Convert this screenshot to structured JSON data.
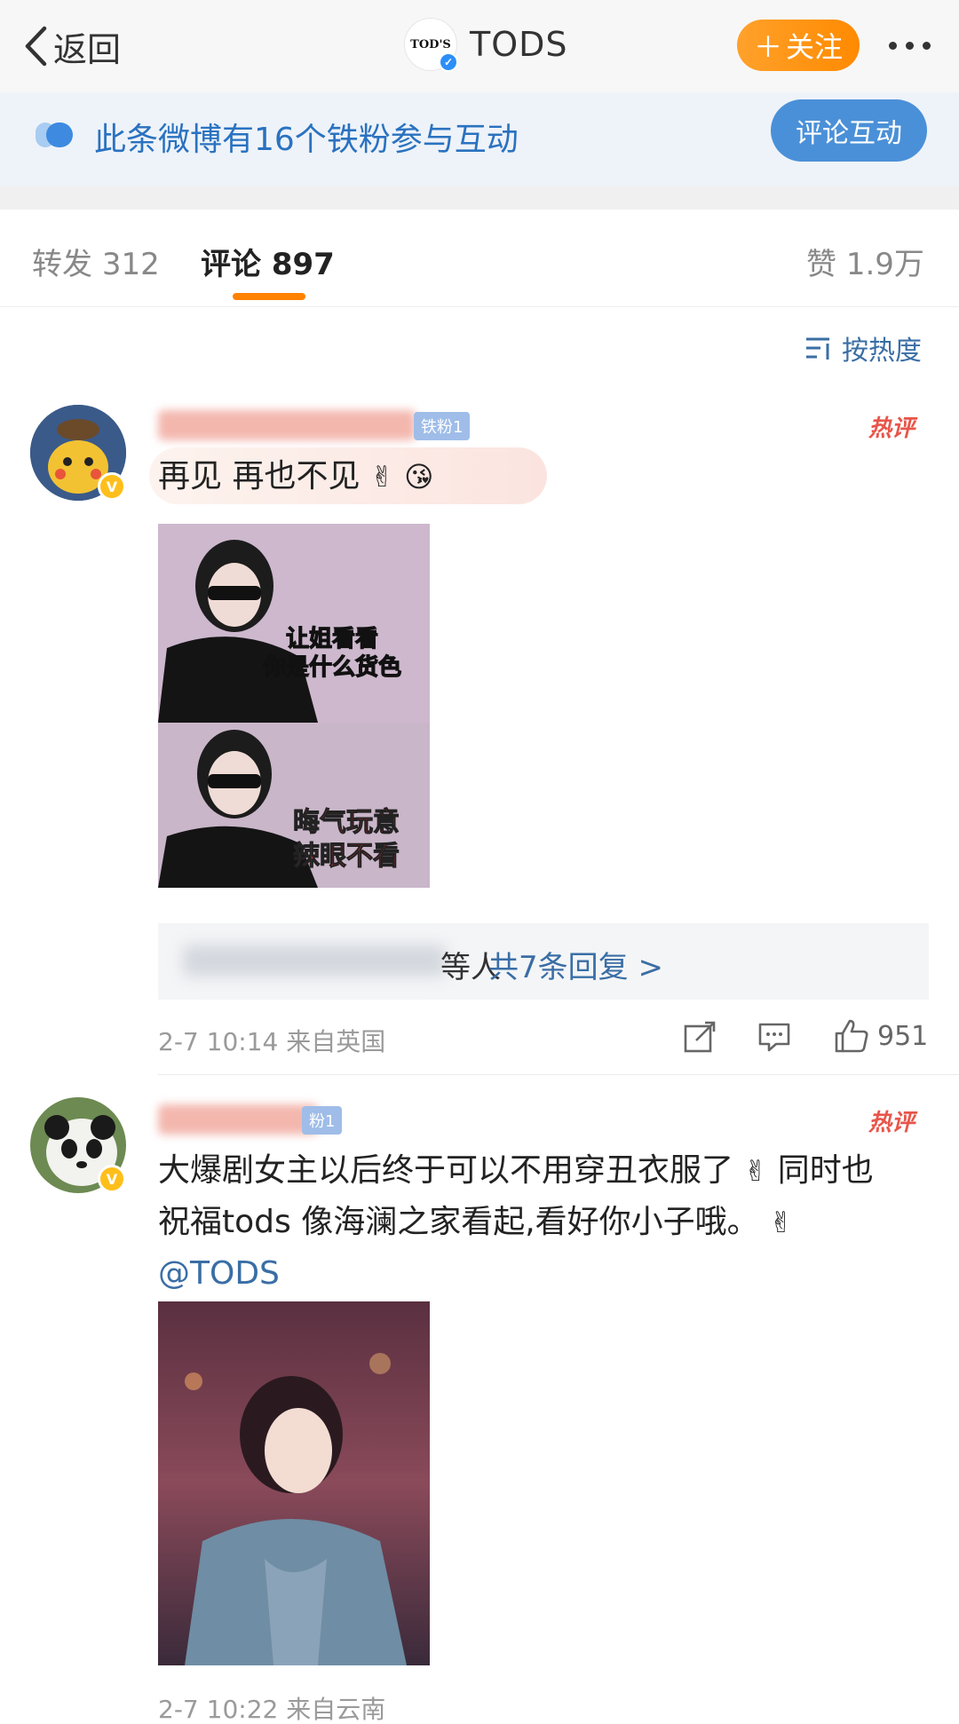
{
  "nav": {
    "back_label": "返回",
    "brand_logo_text": "TOD'S",
    "brand_name": "TODS",
    "follow_label": "关注",
    "follow_plus": "＋"
  },
  "banner": {
    "text": "此条微博有16个铁粉参与互动",
    "button_label": "评论互动"
  },
  "tabs": {
    "repost_label": "转发",
    "repost_count": "312",
    "comment_label": "评论",
    "comment_count": "897",
    "like_label": "赞",
    "like_count": "1.9万"
  },
  "sort": {
    "label": "按热度"
  },
  "comments": [
    {
      "fan_badge": "铁粉1",
      "hot_label": "热评",
      "text": "再见 再也不见",
      "image_caption_top": [
        "让姐看看",
        "你是什么货色"
      ],
      "image_caption_bottom": [
        "晦气玩意",
        "辣眼不看"
      ],
      "reply_person_tail": "等人",
      "reply_more": "共7条回复 >",
      "time": "2-7 10:14",
      "location": "来自英国",
      "likes": "951"
    },
    {
      "fan_badge": "粉1",
      "hot_label": "热评",
      "text_line1": "大爆剧女主以后终于可以不用穿丑衣服了",
      "text_line1_tail": "同时也",
      "text_line2": "祝福tods 像海澜之家看起,看好你小子哦。",
      "mention": "@TODS",
      "time": "2-7 10:22",
      "location": "来自云南"
    }
  ],
  "colors": {
    "accent_orange": "#ff8200",
    "link_blue": "#3a6ea5",
    "hot_red": "#e8554a"
  }
}
